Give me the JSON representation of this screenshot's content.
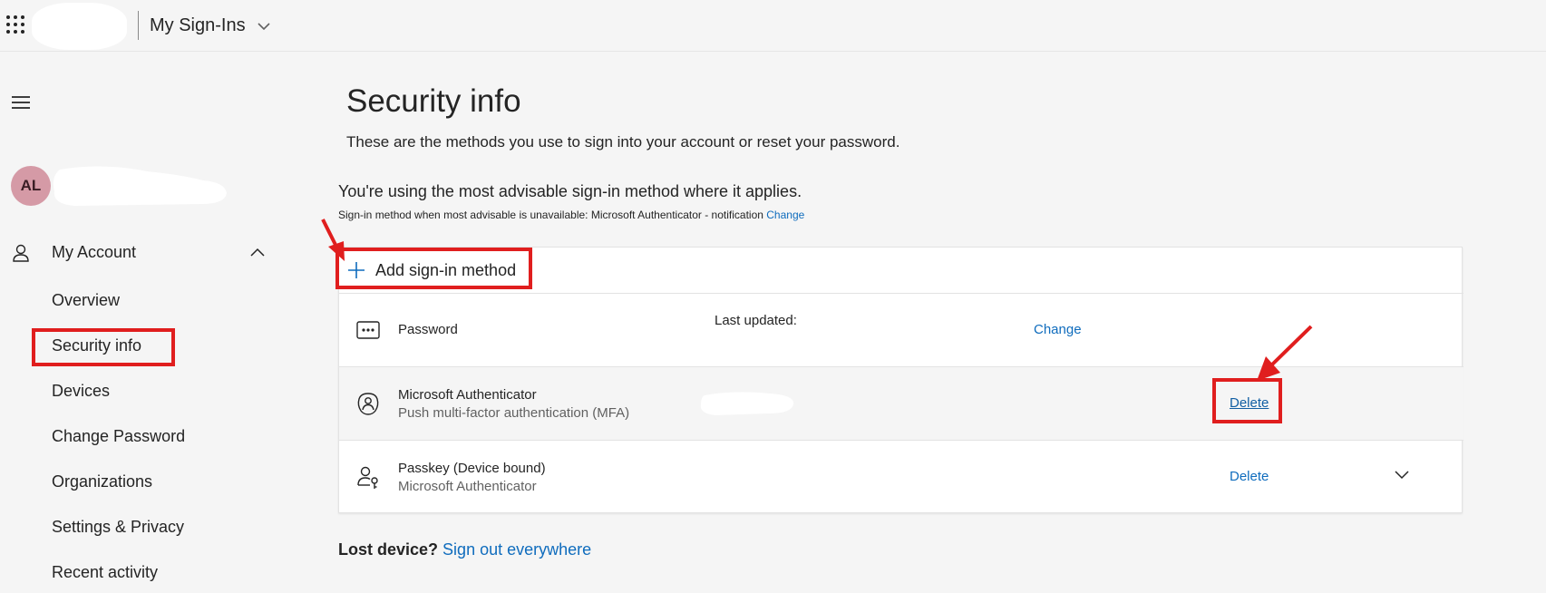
{
  "header": {
    "app_title": "My Sign-Ins",
    "waffle_icon": "app-launcher-icon",
    "chevron_icon": "chevron-down-icon"
  },
  "sidebar": {
    "avatar_initials": "AL",
    "section": {
      "label": "My Account",
      "icon": "person-icon",
      "expanded": true
    },
    "items": [
      {
        "label": "Overview"
      },
      {
        "label": "Security info",
        "active": true
      },
      {
        "label": "Devices"
      },
      {
        "label": "Change Password"
      },
      {
        "label": "Organizations"
      },
      {
        "label": "Settings & Privacy"
      },
      {
        "label": "Recent activity"
      }
    ]
  },
  "main": {
    "title": "Security info",
    "description": "These are the methods you use to sign into your account or reset your password.",
    "advisable": "You're using the most advisable sign-in method where it applies.",
    "fallback_text": "Sign-in method when most advisable is unavailable: Microsoft Authenticator - notification",
    "fallback_change": "Change",
    "add_method_label": "Add sign-in method",
    "methods": [
      {
        "name": "Password",
        "sub": "",
        "center": "Last updated:",
        "action": "Change",
        "icon": "password-dots-icon"
      },
      {
        "name": "Microsoft Authenticator",
        "sub": "Push multi-factor authentication (MFA)",
        "center": "",
        "action": "Delete",
        "icon": "authenticator-icon"
      },
      {
        "name": "Passkey (Device bound)",
        "sub": "Microsoft Authenticator",
        "center": "",
        "action": "Delete",
        "icon": "passkey-icon"
      }
    ],
    "lost_device_label": "Lost device?",
    "sign_out_link": "Sign out everywhere"
  },
  "colors": {
    "accent": "#0f6cbd",
    "annotation": "#e01e1e",
    "avatar_bg": "#d59aa6"
  }
}
